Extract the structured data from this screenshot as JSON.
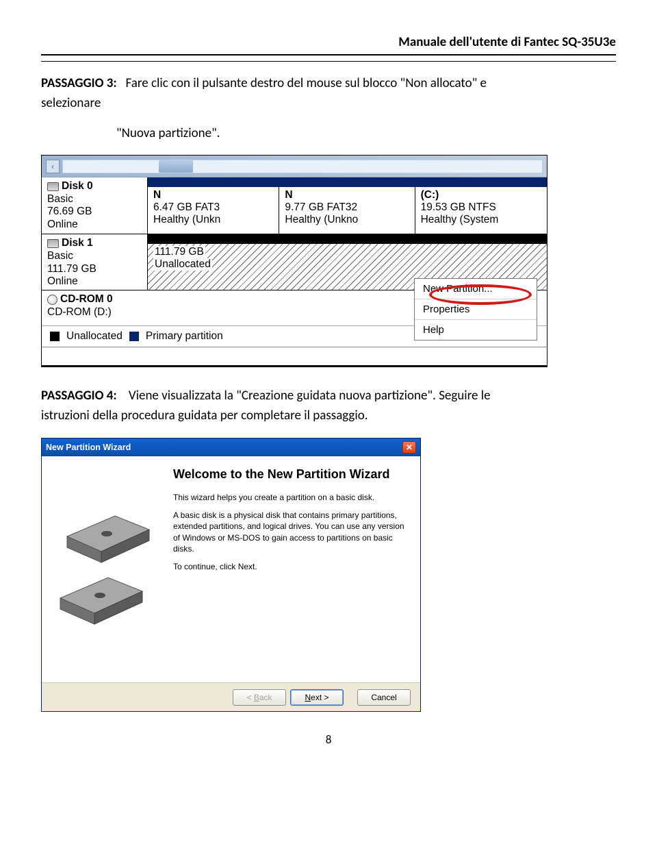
{
  "header": {
    "title": "Manuale dell'utente di Fantec SQ-35U3e"
  },
  "para1": {
    "label": "PASSAGGIO 3:",
    "text_a": "Fare clic con il pulsante destro del mouse sul blocco \"Non allocato\" e",
    "text_b": "selezionare",
    "text_c": "\"Nuova partizione\"."
  },
  "dm": {
    "disk0": {
      "title": "Disk 0",
      "type": "Basic",
      "size": "76.69 GB",
      "status": "Online",
      "parts": [
        {
          "letter": "N",
          "info": "6.47 GB FAT3",
          "health": "Healthy (Unkn"
        },
        {
          "letter": "N",
          "info": "9.77 GB FAT32",
          "health": "Healthy (Unkno"
        },
        {
          "letter": "(C:)",
          "info": "19.53 GB NTFS",
          "health": "Healthy (System"
        }
      ]
    },
    "disk1": {
      "title": "Disk 1",
      "type": "Basic",
      "size": "111.79 GB",
      "status": "Online",
      "unalloc_size": "111.79 GB",
      "unalloc_text": "Unallocated"
    },
    "menu": {
      "new_partition": "New Partition...",
      "properties": "Properties",
      "help": "Help"
    },
    "cdrom": {
      "title": "CD-ROM 0",
      "sub": "CD-ROM (D:)"
    },
    "legend": {
      "unallocated": "Unallocated",
      "primary": "Primary partition"
    }
  },
  "para2": {
    "label": "PASSAGGIO 4:",
    "text_a": "Viene visualizzata la \"Creazione guidata nuova partizione\". Seguire le",
    "text_b": "istruzioni della procedura guidata per completare il passaggio."
  },
  "wizard": {
    "title": "New Partition Wizard",
    "heading": "Welcome to the New Partition Wizard",
    "p1": "This wizard helps you create a partition on a basic disk.",
    "p2": "A basic disk is a physical disk that contains primary partitions, extended partitions, and logical drives. You can use any version of Windows or MS-DOS to gain access to partitions on basic disks.",
    "p3": "To continue, click Next.",
    "back": "< Back",
    "next": "Next >",
    "cancel": "Cancel"
  },
  "page_number": "8"
}
